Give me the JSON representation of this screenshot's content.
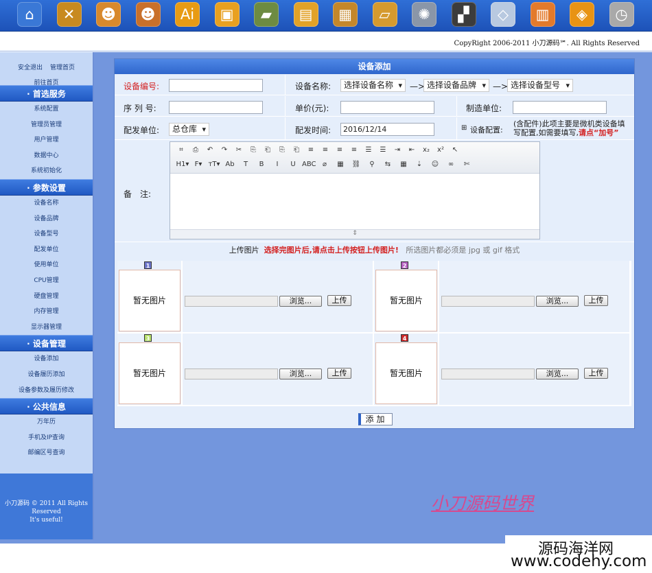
{
  "topbar": {
    "icons": [
      {
        "name": "home-icon",
        "glyph": "⌂",
        "color": "#3a78d6"
      },
      {
        "name": "tools-icon",
        "glyph": "✕",
        "color": "#c88a20"
      },
      {
        "name": "user-icon",
        "glyph": "☻",
        "color": "#d8892c"
      },
      {
        "name": "users-icon",
        "glyph": "☻",
        "color": "#c9702a"
      },
      {
        "name": "ai-icon",
        "glyph": "Ai",
        "color": "#e89b14"
      },
      {
        "name": "briefcase-icon",
        "glyph": "▣",
        "color": "#e8a020"
      },
      {
        "name": "memory-icon",
        "glyph": "▰",
        "color": "#6d8b42"
      },
      {
        "name": "harddisk-icon",
        "glyph": "▤",
        "color": "#e2a228"
      },
      {
        "name": "chip-icon",
        "glyph": "▦",
        "color": "#c4872a"
      },
      {
        "name": "graphics-card-icon",
        "glyph": "▱",
        "color": "#d59a2f"
      },
      {
        "name": "settings-icon",
        "glyph": "✺",
        "color": "#8a96a8"
      },
      {
        "name": "clapper-icon",
        "glyph": "▞",
        "color": "#3c3c3c"
      },
      {
        "name": "package-icon",
        "glyph": "◇",
        "color": "#b8c9e0"
      },
      {
        "name": "calendar-icon",
        "glyph": "▥",
        "color": "#e37a2b"
      },
      {
        "name": "tag-icon",
        "glyph": "◈",
        "color": "#e89314"
      },
      {
        "name": "clock-icon",
        "glyph": "◷",
        "color": "#a9a9a9"
      }
    ]
  },
  "copyright": "CopyRight 2006-2011 小刀源码℠. All Rights Reserved",
  "sidebar": {
    "top_links": [
      "安全退出",
      "管理首页"
    ],
    "front_link": "前往首页",
    "sections": [
      {
        "title": "· 首选服务",
        "items": [
          "系统配置",
          "管理员管理",
          "用户管理",
          "数据中心",
          "系统初始化"
        ]
      },
      {
        "title": "· 参数设置",
        "items": [
          "设备名称",
          "设备品牌",
          "设备型号",
          "配发单位",
          "使用单位",
          "CPU管理",
          "硬盘管理",
          "内存管理",
          "显示器管理"
        ]
      },
      {
        "title": "· 设备管理",
        "items": [
          "设备添加",
          "设备履历添加",
          "设备参数及履历修改"
        ]
      },
      {
        "title": "· 公共信息",
        "items": [
          "万年历",
          "手机及IP查询",
          "邮编区号查询"
        ]
      }
    ],
    "footer": [
      "小刀源码 © 2011 All Rights",
      "Reserved",
      "It's useful!"
    ]
  },
  "form": {
    "title": "设备添加",
    "device_code_label": "设备编号:",
    "device_name_label": "设备名称:",
    "device_name_select": "选择设备名称",
    "brand_select": "选择设备品牌",
    "model_select": "选择设备型号",
    "arrow": "—>",
    "serial_label": "序 列 号:",
    "price_label": "单价(元):",
    "maker_label": "制造单位:",
    "dispatch_unit_label": "配发单位:",
    "dispatch_unit_value": "总仓库",
    "dispatch_time_label": "配发时间:",
    "dispatch_time_value": "2016/12/14",
    "config_toggle": "⊞",
    "config_label": "设备配置:",
    "config_note_1": "(含配件)此项主要是微机类设备填",
    "config_note_2": "写配置,如需要填写,",
    "config_note_red": "请点“加号”",
    "remark_label": "备　注:",
    "editor_toolbar_row1": [
      "⌗",
      "⎙",
      "↶",
      "↷",
      "✂",
      "⎘",
      "⎗",
      "⎘",
      "⎗",
      "≡",
      "≡",
      "≡",
      "≡",
      "☰",
      "☰",
      "⇥",
      "⇤",
      "x₂",
      "x²",
      "↖"
    ],
    "editor_toolbar_row2": [
      "H1▾",
      "F▾",
      "тT▾",
      "Ab",
      "T",
      "B",
      "I",
      "U",
      "ABC",
      "⌀",
      "▦",
      "⛓",
      "⚲",
      "⇆",
      "▦",
      "⇣",
      "☺",
      "∞",
      "✄"
    ],
    "editor_resize": "⇕",
    "upload_label": "上传图片",
    "upload_note_red": "选择完图片后,请点击上传按钮上传图片!",
    "upload_note_gray": "所选图片都必须是 jpg 或 gif 格式",
    "slots": [
      {
        "num": "1",
        "color": "#6b74c9",
        "nopic": "暂无图片",
        "browse": "浏览...",
        "upload": "上传"
      },
      {
        "num": "2",
        "color": "#b55fc0",
        "nopic": "暂无图片",
        "browse": "浏览...",
        "upload": "上传"
      },
      {
        "num": "3",
        "color": "#b7e06a",
        "nopic": "暂无图片",
        "browse": "浏览...",
        "upload": "上传"
      },
      {
        "num": "4",
        "color": "#cc2a2a",
        "nopic": "暂无图片",
        "browse": "浏览...",
        "upload": "上传"
      }
    ],
    "submit": "添加"
  },
  "watermark": "小刀源码世界",
  "site_watermark": {
    "cn": "源码海洋网",
    "url": "www.codehy.com"
  }
}
